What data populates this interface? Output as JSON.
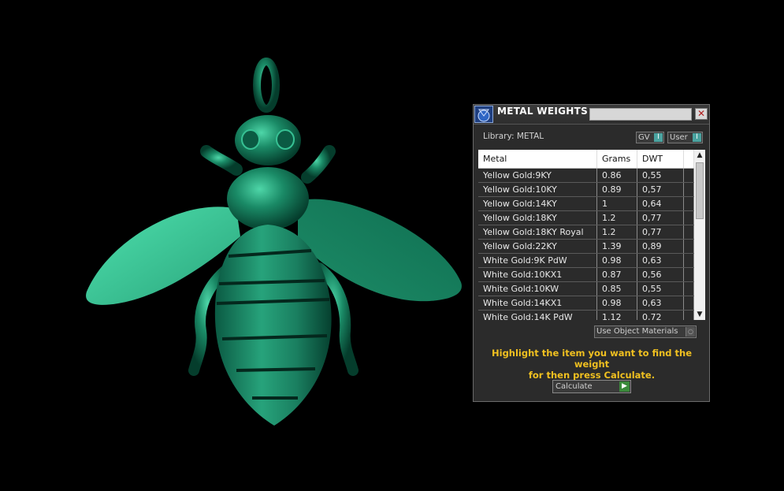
{
  "panel": {
    "title": "METAL WEIGHTS",
    "close_label": "✕",
    "library_label": "Library: METAL",
    "gv_label": "GV",
    "user_label": "User",
    "toggle_indicator": "I",
    "table": {
      "columns": [
        "Metal",
        "Grams",
        "DWT"
      ],
      "rows": [
        [
          "Yellow Gold:9KY",
          "0.86",
          "0,55"
        ],
        [
          "Yellow Gold:10KY",
          "0.89",
          "0,57"
        ],
        [
          "Yellow Gold:14KY",
          "1",
          "0,64"
        ],
        [
          "Yellow Gold:18KY",
          "1.2",
          "0,77"
        ],
        [
          "Yellow Gold:18KY Royal",
          "1.2",
          "0,77"
        ],
        [
          "Yellow Gold:22KY",
          "1.39",
          "0,89"
        ],
        [
          "White Gold:9K PdW",
          "0.98",
          "0,63"
        ],
        [
          "White Gold:10KX1",
          "0.87",
          "0,56"
        ],
        [
          "White Gold:10KW",
          "0.85",
          "0,55"
        ],
        [
          "White Gold:14KX1",
          "0.98",
          "0,63"
        ],
        [
          "White Gold:14K PdW",
          "1.12",
          "0,72"
        ]
      ]
    },
    "use_object_materials": "Use Object Materials",
    "hint_line1": "Highlight the item you want to find the weight",
    "hint_line2": "for then press Calculate.",
    "calculate_label": "Calculate",
    "colors": {
      "model": "#1f8f6a",
      "wing": "#48d6a2",
      "hint": "#f0c020"
    }
  },
  "viewport": {
    "model": "bee-pendant"
  }
}
